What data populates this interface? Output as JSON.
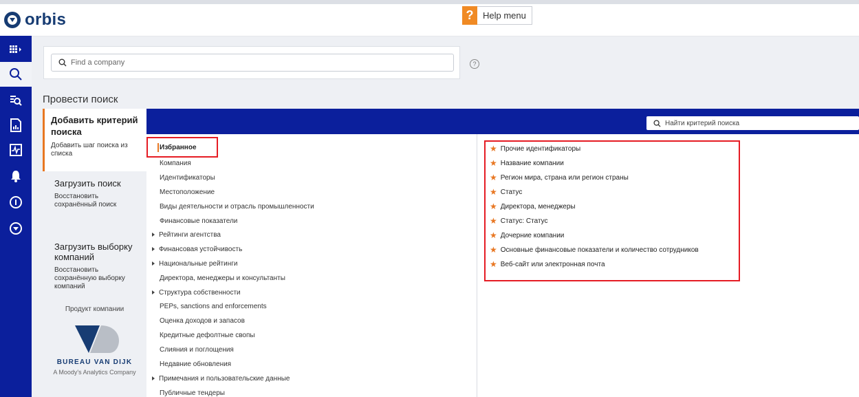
{
  "app": {
    "brand": "orbis"
  },
  "help": {
    "icon": "?",
    "label": "Help menu"
  },
  "search": {
    "placeholder": "Find a company",
    "help_icon": "?"
  },
  "page": {
    "title": "Провести поиск"
  },
  "left_panel": {
    "add": {
      "title": "Добавить критерий поиска",
      "subtitle": "Добавить шаг поиска из списка"
    },
    "load_search": {
      "title": "Загрузить поиск",
      "subtitle": "Восстановить сохранённый поиск"
    },
    "load_selection": {
      "title": "Загрузить выборку компаний",
      "subtitle": "Восстановить сохранённую выборку компаний"
    },
    "product": {
      "label": "Продукт компании",
      "company": "BUREAU VAN DIJK",
      "tagline": "A Moody's Analytics Company"
    }
  },
  "criteria_search": {
    "placeholder": "Найти критерий поиска"
  },
  "categories": [
    {
      "label": "Избранное",
      "arrow": false
    },
    {
      "label": "Компания",
      "arrow": false
    },
    {
      "label": "Идентификаторы",
      "arrow": false
    },
    {
      "label": "Местоположение",
      "arrow": false
    },
    {
      "label": "Виды деятельности и отрасль промышленности",
      "arrow": false
    },
    {
      "label": "Финансовые показатели",
      "arrow": false
    },
    {
      "label": "Рейтинги агентства",
      "arrow": true
    },
    {
      "label": "Финансовая устойчивость",
      "arrow": true
    },
    {
      "label": "Национальные рейтинги",
      "arrow": true
    },
    {
      "label": "Директора, менеджеры и консультанты",
      "arrow": false
    },
    {
      "label": "Структура собственности",
      "arrow": true
    },
    {
      "label": "PEPs, sanctions and enforcements",
      "arrow": false
    },
    {
      "label": "Оценка доходов и запасов",
      "arrow": false
    },
    {
      "label": "Кредитные дефолтные свопы",
      "arrow": false
    },
    {
      "label": "Слияния и поглощения",
      "arrow": false
    },
    {
      "label": "Недавние обновления",
      "arrow": false
    },
    {
      "label": "Примечания и пользовательские данные",
      "arrow": true
    },
    {
      "label": "Публичные тендеры",
      "arrow": false
    }
  ],
  "favorites": [
    "Прочие идентификаторы",
    "Название компании",
    "Регион мира, страна или регион страны",
    "Статус",
    "Директора, менеджеры",
    "Статус: Статус",
    "Дочерние компании",
    "Основные финансовые показатели и количество сотрудников",
    "Веб-сайт или электронная почта"
  ],
  "colors": {
    "nav": "#0b1f9c",
    "accent": "#e87722",
    "highlight": "#e51b23",
    "brand": "#173c73"
  },
  "icons": [
    "grid-apps-icon",
    "search-icon",
    "search-list-icon",
    "report-icon",
    "monitor-icon",
    "bell-icon",
    "info-circle-icon",
    "orbis-circle-icon",
    "star-icon"
  ]
}
